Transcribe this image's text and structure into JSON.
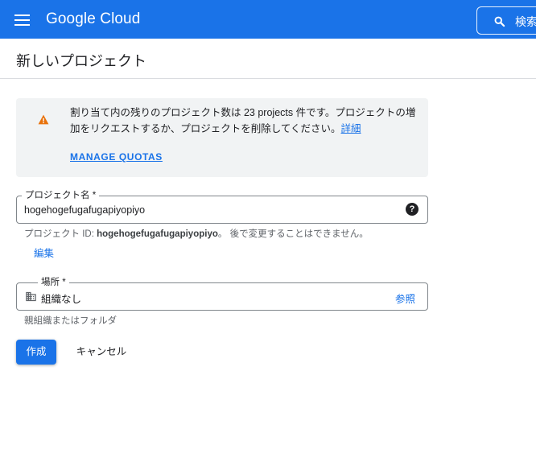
{
  "header": {
    "brand": "Google Cloud",
    "search_label": "検索"
  },
  "page": {
    "title": "新しいプロジェクト"
  },
  "quota_notice": {
    "message": "割り当て内の残りのプロジェクト数は 23 projects 件です。プロジェクトの増加をリクエストするか、プロジェクトを削除してください。",
    "details_link": "詳細",
    "manage_quotas": "MANAGE QUOTAS"
  },
  "project_name": {
    "label": "プロジェクト名 *",
    "value": "hogehogefugafugapiyopiyo",
    "id_prefix": "プロジェクト ID:",
    "id_value": "hogehogefugafugapiyopiyo",
    "id_suffix": "。 後で変更することはできません。",
    "edit_link": "編集"
  },
  "location": {
    "label": "場所 *",
    "value": "組織なし",
    "browse_link": "参照",
    "hint": "親組織またはフォルダ"
  },
  "actions": {
    "create": "作成",
    "cancel": "キャンセル"
  },
  "colors": {
    "primary": "#1a73e8",
    "warning": "#e8710a"
  },
  "icons": {
    "menu": "menu-icon",
    "search": "search-icon",
    "warning": "warning-icon",
    "help": "help-icon",
    "building": "building-icon"
  }
}
